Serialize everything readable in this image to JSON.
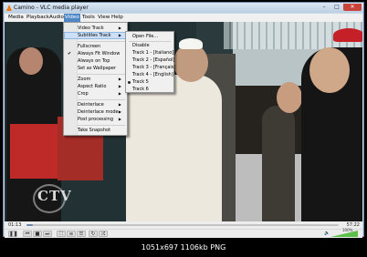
{
  "window": {
    "title": "Camino - VLC media player",
    "minimize_glyph": "–",
    "maximize_glyph": "□",
    "close_glyph": "✕"
  },
  "menubar": [
    "Media",
    "Playback",
    "Audio",
    "Video",
    "Tools",
    "View",
    "Help"
  ],
  "video_menu": {
    "items": [
      {
        "label": "Video Track",
        "submenu": true
      },
      {
        "label": "Subtitles Track",
        "submenu": true,
        "highlighted": true
      },
      {
        "label": "Fullscreen"
      },
      {
        "label": "Always Fit Window",
        "checked": true
      },
      {
        "label": "Always on Top"
      },
      {
        "label": "Set as Wallpaper"
      },
      {
        "label": "Zoom",
        "submenu": true
      },
      {
        "label": "Aspect Ratio",
        "submenu": true
      },
      {
        "label": "Crop",
        "submenu": true
      },
      {
        "label": "Deinterlace",
        "submenu": true
      },
      {
        "label": "Deinterlace mode",
        "submenu": true
      },
      {
        "label": "Post processing",
        "submenu": true
      },
      {
        "label": "Take Snapshot"
      }
    ]
  },
  "subtitles_menu": {
    "items": [
      {
        "label": "Open File..."
      },
      {
        "label": "Disable"
      },
      {
        "label": "Track 1 - [Italiano]"
      },
      {
        "label": "Track 2 - [Español]"
      },
      {
        "label": "Track 3 - [Français]"
      },
      {
        "label": "Track 4 - [English]"
      },
      {
        "label": "Track 5",
        "selected": true
      },
      {
        "label": "Track 6"
      }
    ]
  },
  "video_overlay": {
    "logo_text": "CTV"
  },
  "playback": {
    "current_time": "01:13",
    "total_time": "57:22",
    "progress": 0.021,
    "volume_percent": "100%"
  },
  "controls": {
    "play": "❚❚",
    "prev": "⏮",
    "stop": "■",
    "next": "⏭",
    "fullscreen": "⛶",
    "extended": "≡",
    "playlist": "☰",
    "loop": "↻",
    "random": "⤮",
    "volume_icon": "🔈"
  },
  "caption": "1051x697  1106kb  PNG"
}
